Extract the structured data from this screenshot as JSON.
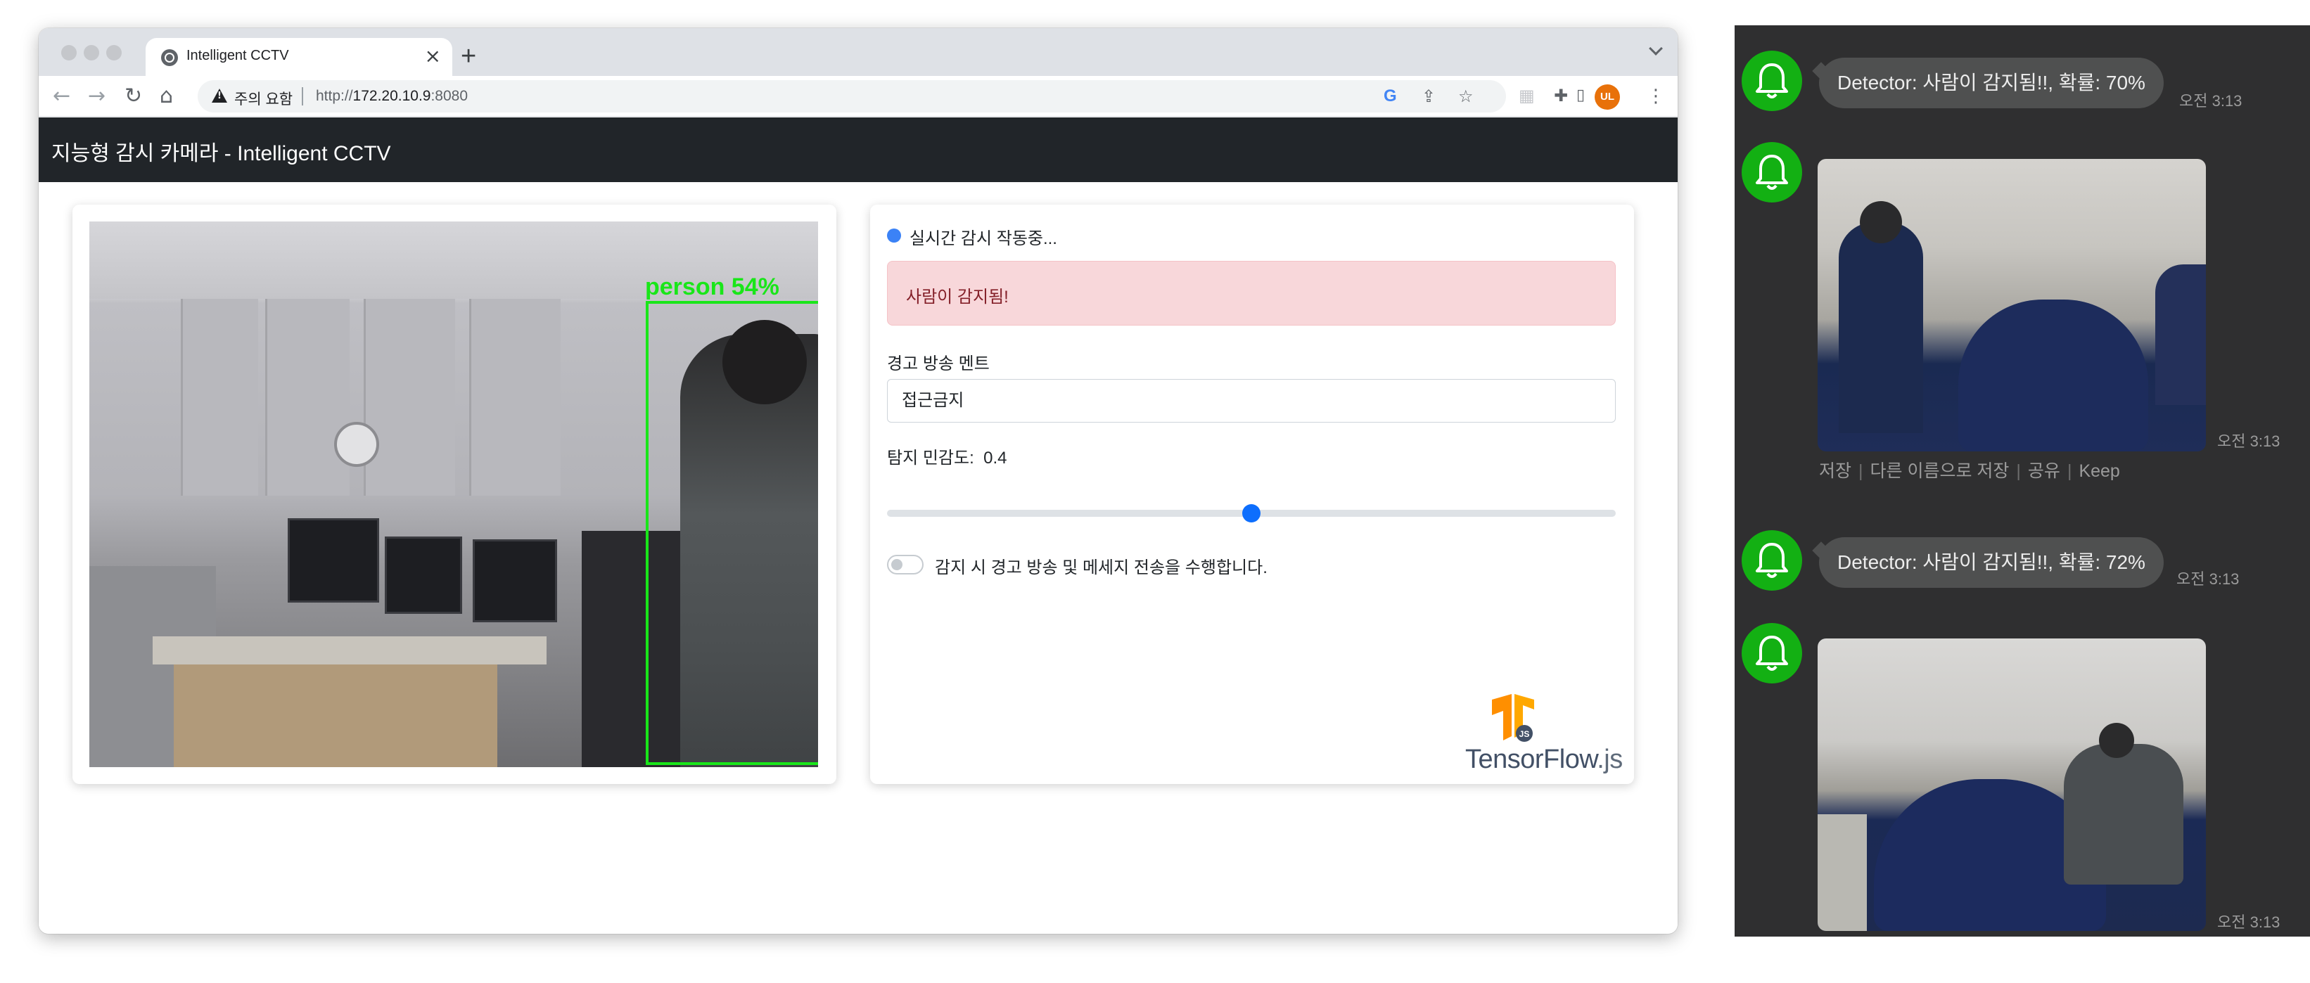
{
  "browser": {
    "tab_title": "Intelligent CCTV",
    "tab_close": "×",
    "new_tab": "+",
    "security_warning": "주의 요함",
    "url_scheme": "http://",
    "url_host": "172.20.10.9",
    "url_port": ":8080",
    "profile_initials": "UL"
  },
  "app": {
    "title": "지능형 감시 카메라 - Intelligent CCTV",
    "detection_label": "person 54%",
    "detection_color": "#19e619",
    "status_text": "실시간 감시 작동중...",
    "alert_text": "사람이 감지됨!",
    "warning_label": "경고 방송 멘트",
    "warning_value": "접근금지",
    "sensitivity_label": "탐지 민감도:",
    "sensitivity_value": "0.4",
    "sensitivity_fraction": 0.5,
    "switch_label": "감지 시 경고 방송 및 메세지 전송을 수행합니다.",
    "switch_on": false,
    "logo_text": "TensorFlow",
    "logo_suffix": ".js"
  },
  "chat": {
    "messages": [
      {
        "type": "text",
        "text": "Detector: 사람이 감지됨!!, 확률: 70%",
        "time": "오전 3:13"
      },
      {
        "type": "image",
        "time": "오전 3:13"
      },
      {
        "type": "text",
        "text": "Detector: 사람이 감지됨!!, 확률: 72%",
        "time": "오전 3:13"
      },
      {
        "type": "image",
        "time": "오전 3:13"
      }
    ],
    "actions": [
      "저장",
      "다른 이름으로 저장",
      "공유",
      "Keep"
    ]
  },
  "colors": {
    "navbar": "#212529",
    "alert_bg": "#f8d7da",
    "accent": "#0d6efd",
    "bell": "#13b013",
    "chat_bg": "#2f2f30"
  }
}
